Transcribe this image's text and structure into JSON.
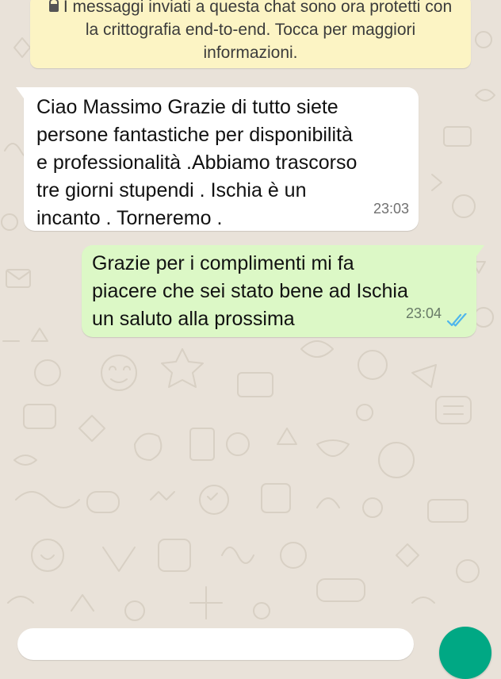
{
  "chat": {
    "encryption_notice": "I messaggi inviati a questa chat sono ora protetti con la crittografia end-to-end. Tocca per maggiori informazioni.",
    "messages": [
      {
        "direction": "incoming",
        "text": "Ciao Massimo Grazie di tutto siete\npersone fantastiche per disponibilità\ne professionalità .Abbiamo trascorso\ntre giorni stupendi . Ischia è un\nincanto . Torneremo .",
        "time": "23:03"
      },
      {
        "direction": "outgoing",
        "text": "Grazie per i complimenti mi fa\npiacere che sei stato bene ad Ischia\nun saluto alla prossima",
        "time": "23:04",
        "status": "read"
      }
    ]
  },
  "icons": {
    "lock": "lock-icon",
    "read_receipt": "double-check-icon",
    "send": "send-button-icon"
  },
  "colors": {
    "chat_background": "#e9e2d9",
    "notice_background": "#fcf4c4",
    "incoming_bubble": "#ffffff",
    "outgoing_bubble": "#dcf8c6",
    "read_tick": "#4fb6ec",
    "fab": "#00a884"
  }
}
